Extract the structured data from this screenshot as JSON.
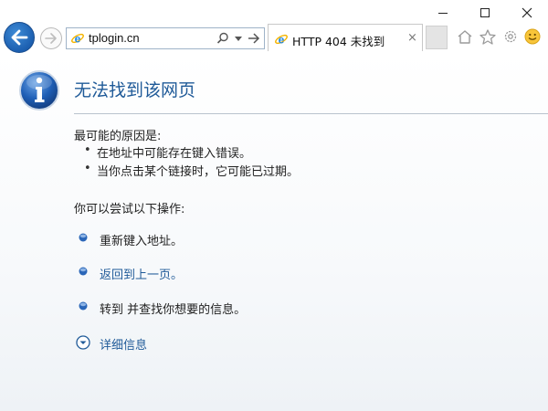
{
  "browser": {
    "address_url": "tplogin.cn",
    "tab_title": "HTTP 404 未找到",
    "tab_close": "×"
  },
  "page": {
    "title": "无法找到该网页",
    "reasons_heading": "最可能的原因是:",
    "reasons": [
      "在地址中可能存在键入错误。",
      "当你点击某个链接时，它可能已过期。"
    ],
    "actions_heading": "你可以尝试以下操作:",
    "actions": [
      "重新键入地址。",
      "返回到上一页。",
      "转到  并查找你想要的信息。"
    ],
    "details_label": "详细信息"
  },
  "colors": {
    "accent": "#1f5a98",
    "back_button": "#1c5fb0"
  },
  "icons": [
    "back-arrow-icon",
    "forward-arrow-icon",
    "ie-logo-icon",
    "search-icon",
    "dropdown-icon",
    "refresh-arrow-icon",
    "home-icon",
    "star-icon",
    "gear-icon",
    "smiley-icon",
    "info-icon",
    "bullet-dot-icon",
    "chevron-down-circle-icon"
  ]
}
